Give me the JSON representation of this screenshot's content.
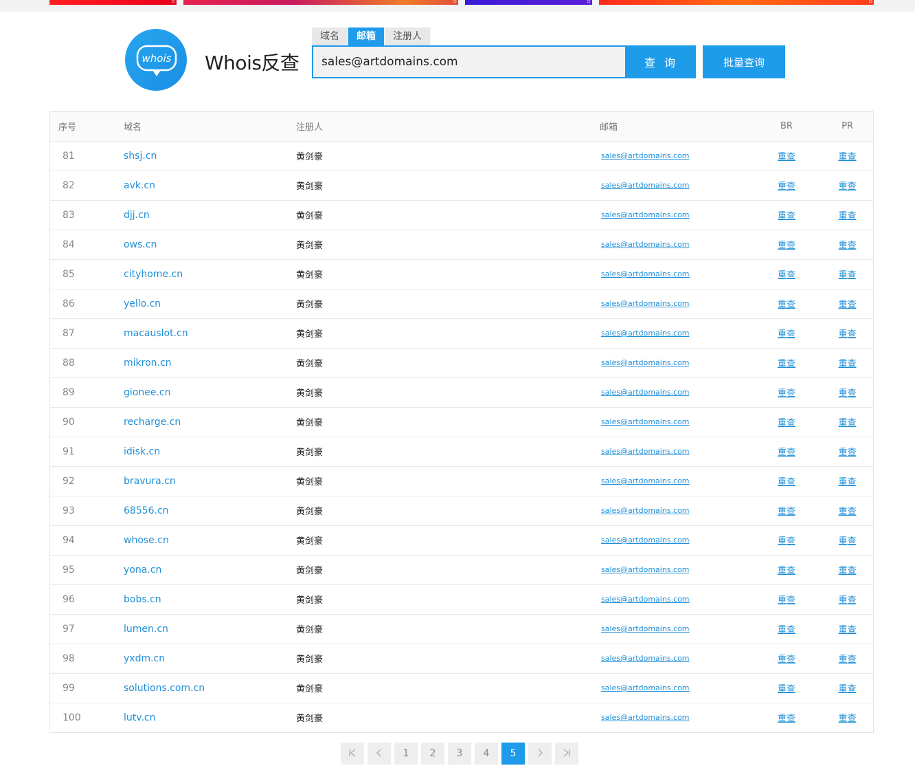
{
  "brand": {
    "logo_text": "whois",
    "title": "Whois反查"
  },
  "tabs": [
    {
      "label": "域名",
      "active": false
    },
    {
      "label": "邮箱",
      "active": true
    },
    {
      "label": "注册人",
      "active": false
    }
  ],
  "search": {
    "value": "sales@artdomains.com",
    "query_label": "查 询",
    "batch_label": "批量查询"
  },
  "table": {
    "headers": {
      "no": "序号",
      "domain": "域名",
      "registrant": "注册人",
      "email": "邮箱",
      "br": "BR",
      "pr": "PR"
    },
    "recheck_label": "重查",
    "rows": [
      {
        "no": "81",
        "domain": "shsj.cn",
        "registrant": "黄剑豪",
        "email": "sales@artdomains.com "
      },
      {
        "no": "82",
        "domain": "avk.cn",
        "registrant": "黄剑豪",
        "email": "sales@artdomains.com "
      },
      {
        "no": "83",
        "domain": "djj.cn",
        "registrant": "黄剑豪",
        "email": "sales@artdomains.com "
      },
      {
        "no": "84",
        "domain": "ows.cn",
        "registrant": "黄剑豪",
        "email": "sales@artdomains.com "
      },
      {
        "no": "85",
        "domain": "cityhome.cn",
        "registrant": "黄剑豪",
        "email": "sales@artdomains.com "
      },
      {
        "no": "86",
        "domain": "yello.cn",
        "registrant": "黄剑豪",
        "email": "sales@artdomains.com "
      },
      {
        "no": "87",
        "domain": "macauslot.cn",
        "registrant": "黄剑豪",
        "email": "sales@artdomains.com "
      },
      {
        "no": "88",
        "domain": "mikron.cn",
        "registrant": "黄剑豪",
        "email": "sales@artdomains.com "
      },
      {
        "no": "89",
        "domain": "gionee.cn",
        "registrant": "黄剑豪",
        "email": "sales@artdomains.com "
      },
      {
        "no": "90",
        "domain": "recharge.cn",
        "registrant": "黄剑豪",
        "email": "sales@artdomains.com "
      },
      {
        "no": "91",
        "domain": "idisk.cn",
        "registrant": "黄剑豪",
        "email": "sales@artdomains.com "
      },
      {
        "no": "92",
        "domain": "bravura.cn",
        "registrant": "黄剑豪",
        "email": "sales@artdomains.com "
      },
      {
        "no": "93",
        "domain": "68556.cn",
        "registrant": "黄剑豪",
        "email": "sales@artdomains.com "
      },
      {
        "no": "94",
        "domain": "whose.cn",
        "registrant": "黄剑豪",
        "email": "sales@artdomains.com "
      },
      {
        "no": "95",
        "domain": "yona.cn",
        "registrant": "黄剑豪",
        "email": "sales@artdomains.com "
      },
      {
        "no": "96",
        "domain": "bobs.cn",
        "registrant": "黄剑豪",
        "email": "sales@artdomains.com "
      },
      {
        "no": "97",
        "domain": "lumen.cn",
        "registrant": "黄剑豪",
        "email": "sales@artdomains.com "
      },
      {
        "no": "98",
        "domain": "yxdm.cn",
        "registrant": "黄剑豪",
        "email": "sales@artdomains.com "
      },
      {
        "no": "99",
        "domain": "solutions.com.cn",
        "registrant": "黄剑豪",
        "email": "sales@artdomains.com "
      },
      {
        "no": "100",
        "domain": "lutv.cn",
        "registrant": "黄剑豪",
        "email": "sales@artdomains.com "
      }
    ]
  },
  "pagination": {
    "pages": [
      "1",
      "2",
      "3",
      "4",
      "5"
    ],
    "current": "5"
  },
  "colors": {
    "accent": "#1e9be9",
    "link": "#1f8fd8"
  }
}
